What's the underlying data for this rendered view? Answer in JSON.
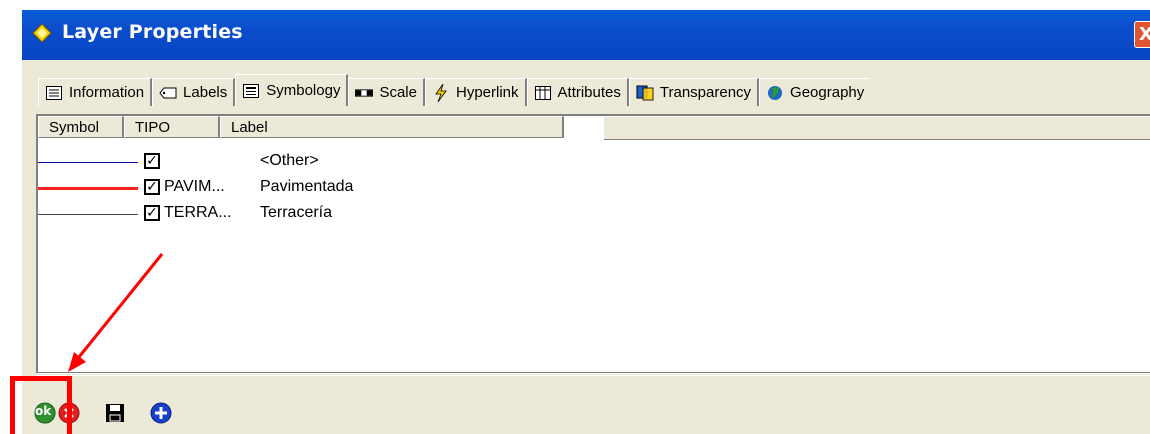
{
  "window": {
    "title": "Layer Properties",
    "close_label": "X"
  },
  "tabs": [
    {
      "label": "Information",
      "icon": "information-icon"
    },
    {
      "label": "Labels",
      "icon": "labels-icon"
    },
    {
      "label": "Symbology",
      "icon": "symbology-icon",
      "active": true
    },
    {
      "label": "Scale",
      "icon": "scale-icon"
    },
    {
      "label": "Hyperlink",
      "icon": "hyperlink-icon"
    },
    {
      "label": "Attributes",
      "icon": "attributes-icon"
    },
    {
      "label": "Transparency",
      "icon": "transparency-icon"
    },
    {
      "label": "Geography",
      "icon": "geography-icon"
    }
  ],
  "table": {
    "columns": [
      "Symbol",
      "TIPO",
      "Label"
    ],
    "rows": [
      {
        "tipo": "",
        "label": "<Other>",
        "line_color": "#0000a0",
        "checked": true
      },
      {
        "tipo": "PAVIM...",
        "label": "Pavimentada",
        "line_color": "#ff2020",
        "checked": true
      },
      {
        "tipo": "TERRA...",
        "label": "Terracería",
        "line_color": "#404050",
        "checked": true
      }
    ]
  },
  "toolbar": {
    "ok_label": "ok",
    "buttons": [
      "ok-icon",
      "cancel-icon",
      "save-icon",
      "add-icon"
    ]
  },
  "colors": {
    "titlebar": "#0a4ccc",
    "dialog_bg": "#ece9d8",
    "annotation": "#ff0000"
  }
}
